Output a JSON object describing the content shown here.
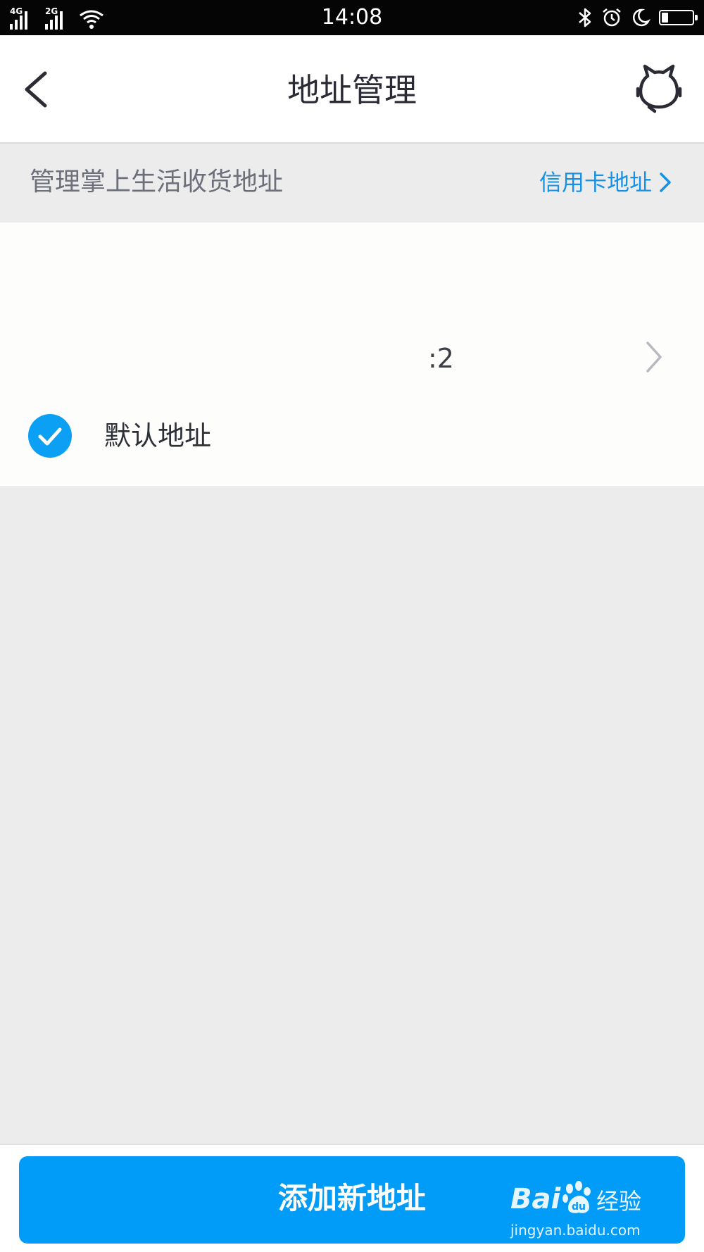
{
  "status_bar": {
    "network_1": "4G",
    "network_2": "2G",
    "time": "14:08",
    "icons": [
      "signal-icon",
      "signal-icon",
      "wifi-icon",
      "bluetooth-icon",
      "alarm-icon",
      "moon-icon",
      "battery-icon"
    ],
    "battery_level": 0.22
  },
  "nav": {
    "title": "地址管理",
    "back_icon": "chevron-left-icon",
    "service_icon": "cat-head-icon"
  },
  "subheader": {
    "description": "管理掌上生活收货地址",
    "link_label": "信用卡地址",
    "link_icon": "chevron-right-icon"
  },
  "address_card": {
    "visible_text": ":2",
    "chevron_icon": "chevron-right-icon",
    "default_checked": true,
    "default_label": "默认地址"
  },
  "bottom": {
    "add_button_label": "添加新地址"
  },
  "watermark": {
    "brand": "Bai",
    "brand_suffix": "经验",
    "site": "jingyan.baidu.com"
  },
  "colors": {
    "accent": "#009cf7",
    "link": "#1592e6",
    "check": "#0ba0f4",
    "background": "#ececed",
    "status_bar": "#050505"
  }
}
